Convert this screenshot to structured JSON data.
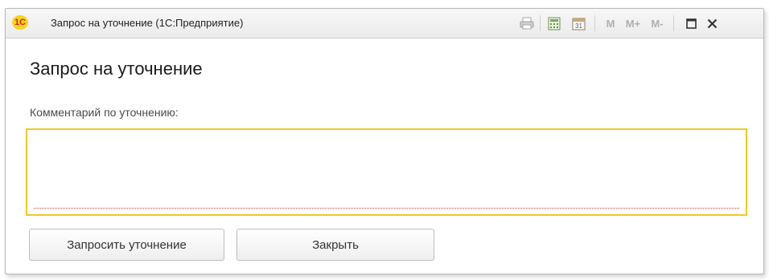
{
  "window": {
    "logo_text": "1С",
    "title": "Запрос на уточнение  (1С:Предприятие)",
    "toolbar": {
      "print_icon": "printer-icon",
      "calculator_icon": "calculator-icon",
      "calendar_icon": "calendar-icon",
      "calendar_day": "31",
      "mem_m": "M",
      "mem_mplus": "M+",
      "mem_mminus": "M-",
      "maximize_icon": "maximize-icon",
      "close_icon": "close-icon"
    }
  },
  "form": {
    "heading": "Запрос на уточнение",
    "comment_label": "Комментарий по уточнению:",
    "comment_value": "",
    "accent_color": "#f0c827"
  },
  "buttons": {
    "request_label": "Запросить уточнение",
    "close_label": "Закрыть"
  }
}
